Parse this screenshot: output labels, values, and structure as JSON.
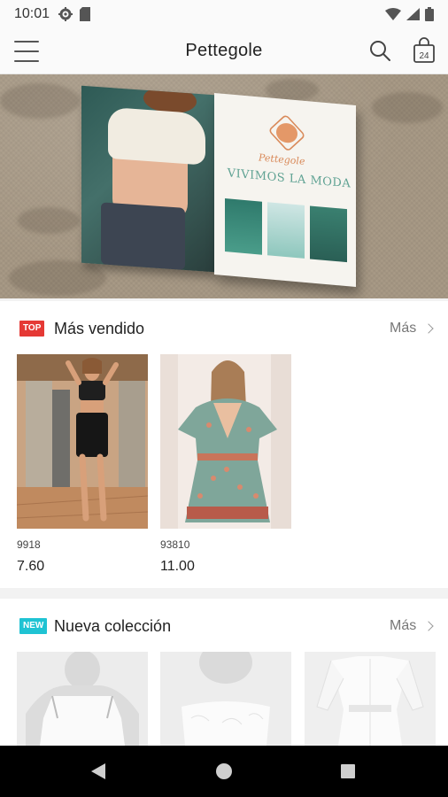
{
  "status_bar": {
    "time": "10:01"
  },
  "app_bar": {
    "title": "Pettegole",
    "cart_count": "24"
  },
  "banner": {
    "brand": "Pettegole",
    "headline": "VIVIMOS LA MODA"
  },
  "best_sellers": {
    "badge": "TOP",
    "badge_color": "#e53935",
    "title": "Más vendido",
    "more_label": "Más",
    "products": [
      {
        "id": "9918",
        "price": "7.60"
      },
      {
        "id": "93810",
        "price": "11.00"
      }
    ]
  },
  "new_collection": {
    "badge": "NEW",
    "badge_color": "#1fc3d3",
    "title": "Nueva colección",
    "more_label": "Más"
  },
  "icons": [
    "gear-icon",
    "sd-card-icon",
    "wifi-icon",
    "signal-icon",
    "battery-icon",
    "menu-icon",
    "search-icon",
    "shopping-bag-icon",
    "back-icon",
    "home-icon",
    "recents-icon"
  ]
}
